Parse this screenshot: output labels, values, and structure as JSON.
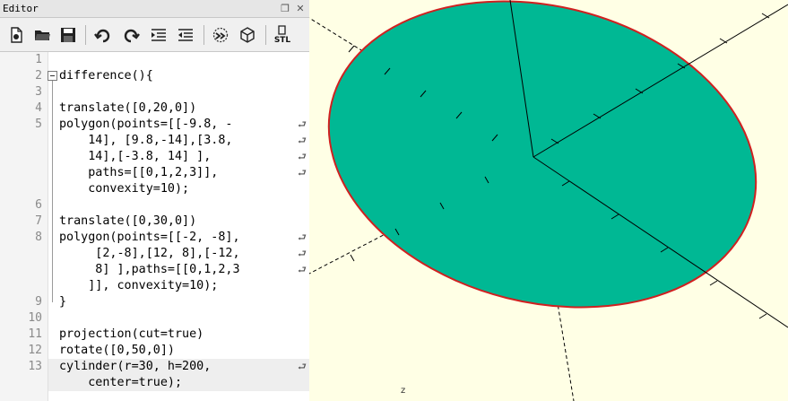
{
  "editor": {
    "title": "Editor",
    "toolbar": {
      "new_icon": "new-file-icon",
      "open_icon": "open-folder-icon",
      "save_icon": "save-disk-icon",
      "undo_icon": "undo-icon",
      "redo_icon": "redo-icon",
      "indent_icon": "indent-icon",
      "unindent_icon": "unindent-icon",
      "preview_icon": "preview-icon",
      "render_icon": "render-cube-icon",
      "stl_label": "STL"
    },
    "lines": [
      {
        "no": "1",
        "text": ""
      },
      {
        "no": "2",
        "text": "difference(){"
      },
      {
        "no": "3",
        "text": ""
      },
      {
        "no": "4",
        "text": "translate([0,20,0])"
      },
      {
        "no": "5",
        "text": "polygon(points=[[-9.8, -"
      },
      {
        "no": "",
        "text": "    14], [9.8,-14],[3.8,"
      },
      {
        "no": "",
        "text": "    14],[-3.8, 14] ],"
      },
      {
        "no": "",
        "text": "    paths=[[0,1,2,3]],"
      },
      {
        "no": "",
        "text": "    convexity=10);"
      },
      {
        "no": "6",
        "text": ""
      },
      {
        "no": "7",
        "text": "translate([0,30,0])"
      },
      {
        "no": "8",
        "text": "polygon(points=[[-2, -8],"
      },
      {
        "no": "",
        "text": "     [2,-8],[12, 8],[-12,"
      },
      {
        "no": "",
        "text": "     8] ],paths=[[0,1,2,3"
      },
      {
        "no": "",
        "text": "    ]], convexity=10);"
      },
      {
        "no": "9",
        "text": "}"
      },
      {
        "no": "10",
        "text": ""
      },
      {
        "no": "11",
        "text": "projection(cut=true)"
      },
      {
        "no": "12",
        "text": "rotate([0,50,0])"
      },
      {
        "no": "13",
        "text": "cylinder(r=30, h=200,"
      },
      {
        "no": "",
        "text": "    center=true);"
      }
    ]
  },
  "viewport": {
    "axis_label_z": "z",
    "background": "#ffffe5",
    "shape_fill": "#00b894",
    "shape_stroke": "#d02020"
  }
}
